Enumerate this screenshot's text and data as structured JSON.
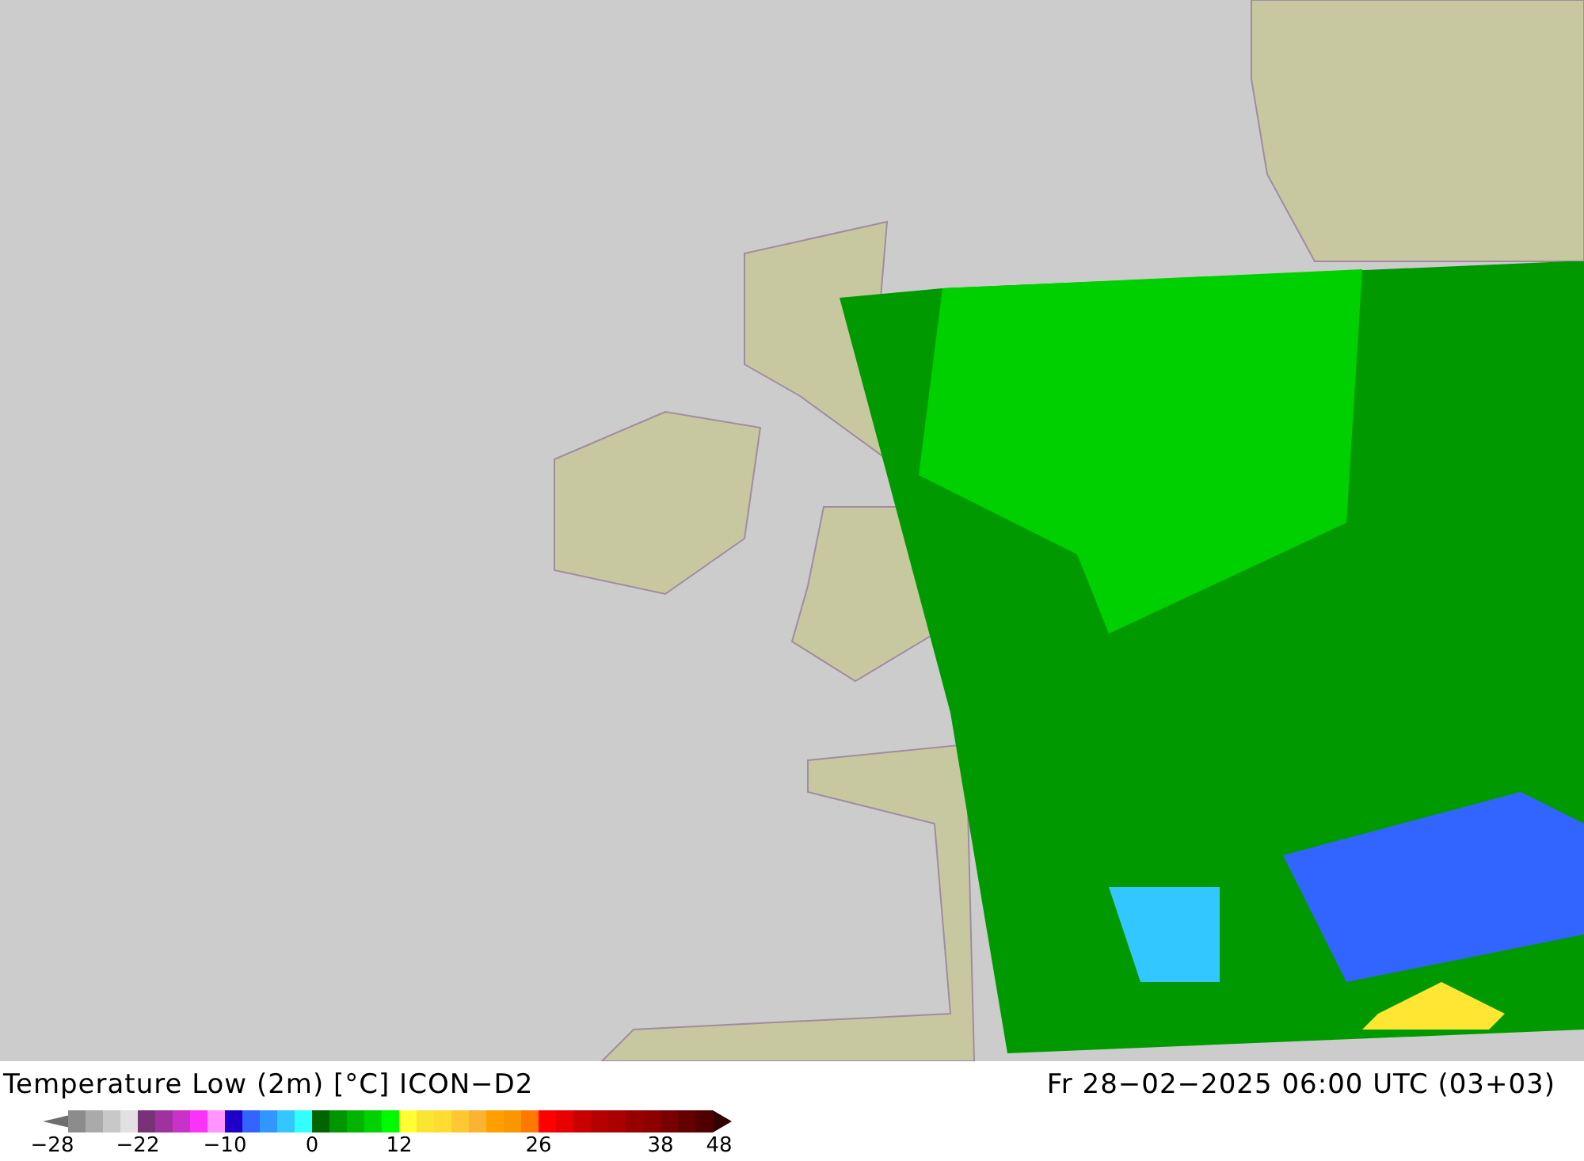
{
  "title": "Temperature Low (2m) [°C] ICON−D2",
  "valid_time": "Fr 28−02−2025 06:00 UTC (03+03)",
  "legend": {
    "left_arrow": {
      "color": "#6e6e6e",
      "tick": "−28"
    },
    "swatches": [
      {
        "color": "#8c8c8c"
      },
      {
        "color": "#aaaaaa"
      },
      {
        "color": "#c8c8c8"
      },
      {
        "color": "#e1e1e1"
      },
      {
        "color": "#783278",
        "tick": "−22"
      },
      {
        "color": "#a032a0"
      },
      {
        "color": "#c832c8"
      },
      {
        "color": "#fa32fa"
      },
      {
        "color": "#ff96ff"
      },
      {
        "color": "#1e00c8",
        "tick": "−10"
      },
      {
        "color": "#3264ff"
      },
      {
        "color": "#3296ff"
      },
      {
        "color": "#32c8ff"
      },
      {
        "color": "#32ffff"
      },
      {
        "color": "#006400",
        "tick": "0"
      },
      {
        "color": "#009600"
      },
      {
        "color": "#00b400"
      },
      {
        "color": "#00d200"
      },
      {
        "color": "#00fa00"
      },
      {
        "color": "#ffff32",
        "tick": "12"
      },
      {
        "color": "#fae632"
      },
      {
        "color": "#ffdc32"
      },
      {
        "color": "#ffc832"
      },
      {
        "color": "#fab432"
      },
      {
        "color": "#ffa000"
      },
      {
        "color": "#fa9600"
      },
      {
        "color": "#ff7800"
      },
      {
        "color": "#ff0000",
        "tick": "26"
      },
      {
        "color": "#e60000"
      },
      {
        "color": "#c80000"
      },
      {
        "color": "#b40000"
      },
      {
        "color": "#aa0000"
      },
      {
        "color": "#960000"
      },
      {
        "color": "#8c0000"
      },
      {
        "color": "#780000",
        "tick": "38"
      },
      {
        "color": "#640000"
      },
      {
        "color": "#500000"
      }
    ],
    "right_arrow": {
      "color": "#320000",
      "tick": "48"
    }
  }
}
